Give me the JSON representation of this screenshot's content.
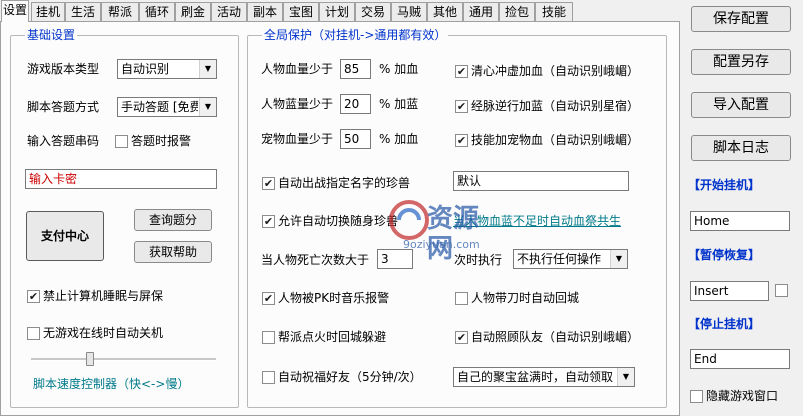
{
  "tabs": [
    "设置",
    "挂机",
    "生活",
    "帮派",
    "循环",
    "刷金",
    "活动",
    "副本",
    "宝图",
    "计划",
    "交易",
    "马贼",
    "其他",
    "通用",
    "捡包",
    "技能"
  ],
  "basic": {
    "title": "基础设置",
    "version_label": "游戏版本类型",
    "version_value": "自动识别",
    "answer_label": "脚本答题方式",
    "answer_value": "手动答题 [免费]",
    "code_label": "输入答题串码",
    "alarm_label": "答题时报警",
    "alarm_checked": false,
    "card_placeholder": "输入卡密",
    "pay_button": "支付中心",
    "query_button": "查询题分",
    "help_button": "获取帮助",
    "sleep_label": "禁止计算机睡眠与屏保",
    "sleep_checked": true,
    "shutdown_label": "无游戏在线时自动关机",
    "shutdown_checked": false,
    "speed_label": "脚本速度控制器（快<->慢）",
    "speed_fraction": 0.32
  },
  "global": {
    "title": "全局保护（对挂机->通用都有效）",
    "hp_label": "人物血量少于",
    "hp_value": "85",
    "hp_unit": "% 加血",
    "mp_label": "人物蓝量少于",
    "mp_value": "20",
    "mp_unit": "% 加蓝",
    "pet_label": "宠物血量少于",
    "pet_value": "50",
    "pet_unit": "% 加血",
    "qing_label": "清心冲虚加血（自动识别峨嵋）",
    "qing_checked": true,
    "jing_label": "经脉逆行加蓝（自动识别星宿）",
    "jing_checked": true,
    "skill_label": "技能加宠物血（自动识别峨嵋）",
    "skill_checked": true,
    "auto_pet_label": "自动出战指定名字的珍兽",
    "auto_pet_checked": true,
    "pet_name_value": "默认",
    "switch_label": "允许自动切换随身珍兽",
    "switch_checked": true,
    "link_text": "当人物血蓝不足时自动血祭共生",
    "death_label": "当人物死亡次数大于",
    "death_value": "3",
    "next_label": "次时执行",
    "next_value": "不执行任何操作",
    "pk_label": "人物被PK时音乐报警",
    "pk_checked": true,
    "knife_label": "人物带刀时自动回城",
    "knife_checked": false,
    "fire_label": "帮派点火时回城躲避",
    "fire_checked": false,
    "team_label": "自动照顾队友（自动识别峨嵋）",
    "team_checked": true,
    "bless_label": "自动祝福好友（5分钟/次）",
    "bless_checked": false,
    "treasure_value": "自己的聚宝盆满时，自动领取"
  },
  "right": {
    "save": "保存配置",
    "saveas": "配置另存",
    "import": "导入配置",
    "log": "脚本日志",
    "start_label": "【开始挂机】",
    "start_key": "Home",
    "pause_label": "【暂停恢复】",
    "pause_key": "Insert",
    "pause_checked": false,
    "stop_label": "【停止挂机】",
    "stop_key": "End",
    "hide_label": "隐藏游戏窗口",
    "hide_checked": false
  },
  "watermark": {
    "main": "资源网",
    "sub": "9oziyuan.com"
  }
}
